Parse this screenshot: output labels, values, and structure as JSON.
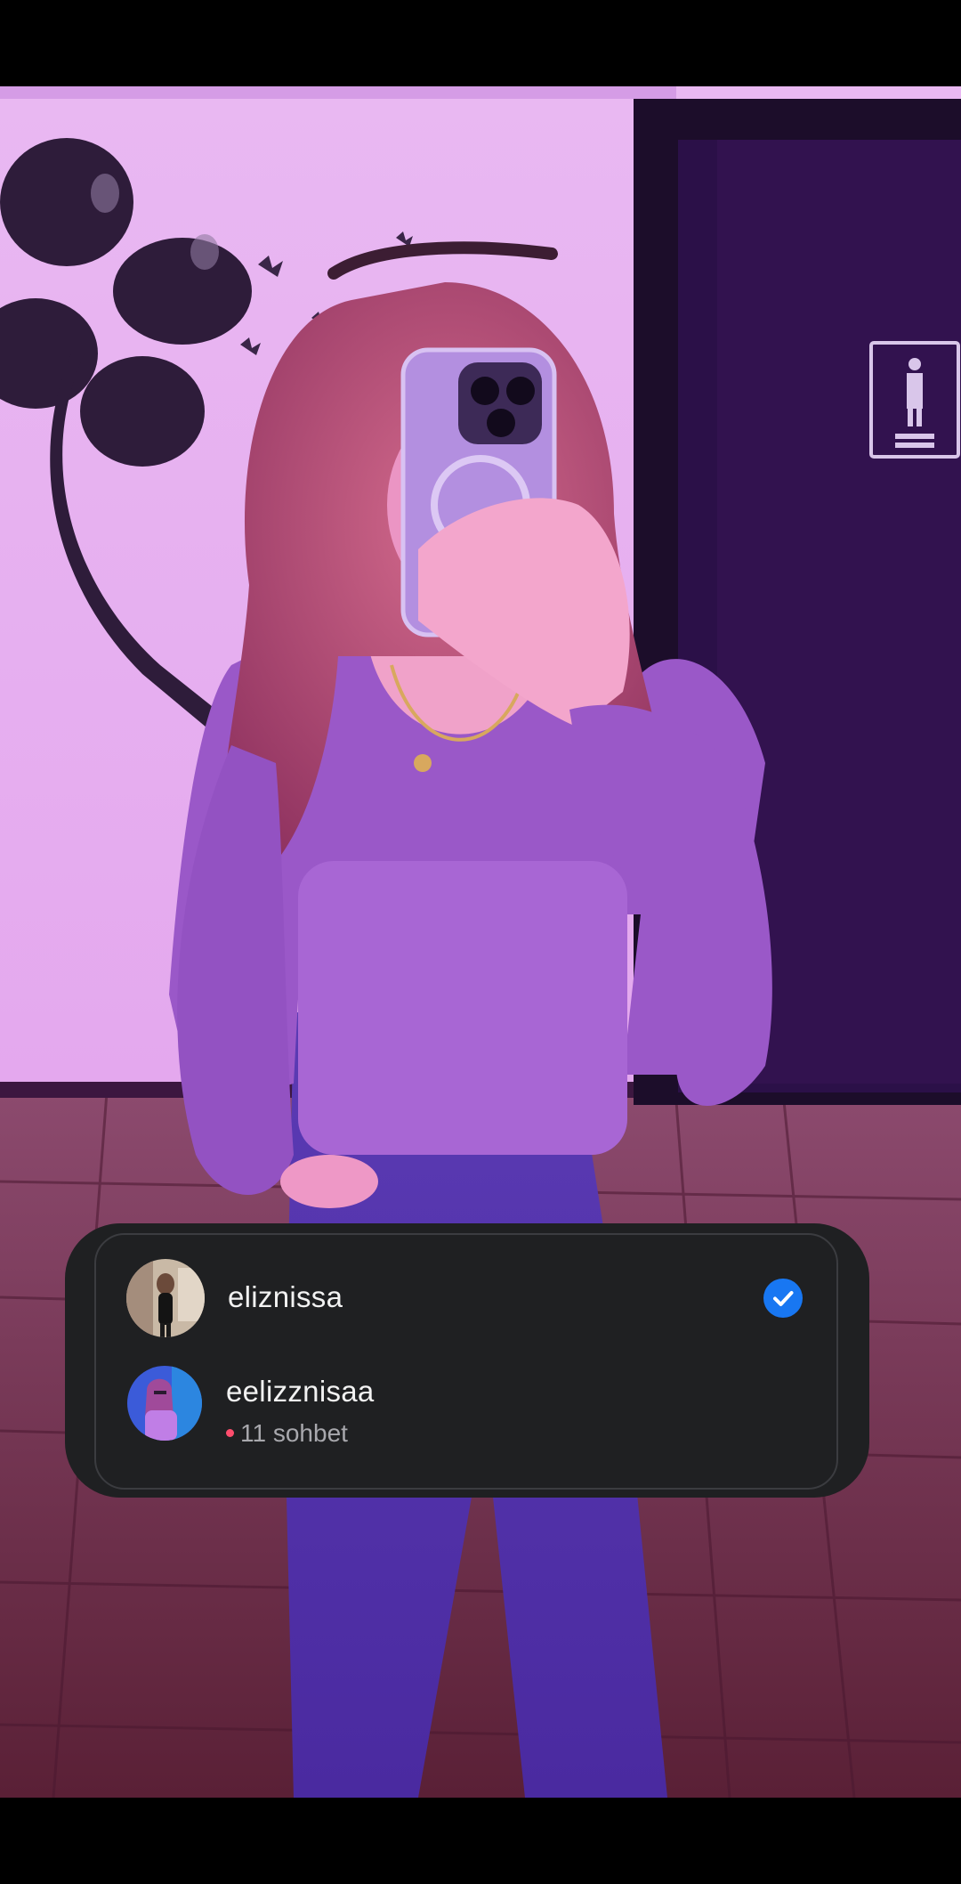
{
  "accounts": [
    {
      "username": "eliznissa",
      "selected": true,
      "indicator_icon": "check-circle-icon"
    },
    {
      "username": "eelizznisaa",
      "unread_count": "11 sohbet",
      "indicator_icon": "unread-dot-icon"
    }
  ],
  "colors": {
    "panel_background": "#1f2022",
    "panel_border": "#3b3c40",
    "check_blue": "#1877f2",
    "unread_dot": "#ff4d6d"
  }
}
